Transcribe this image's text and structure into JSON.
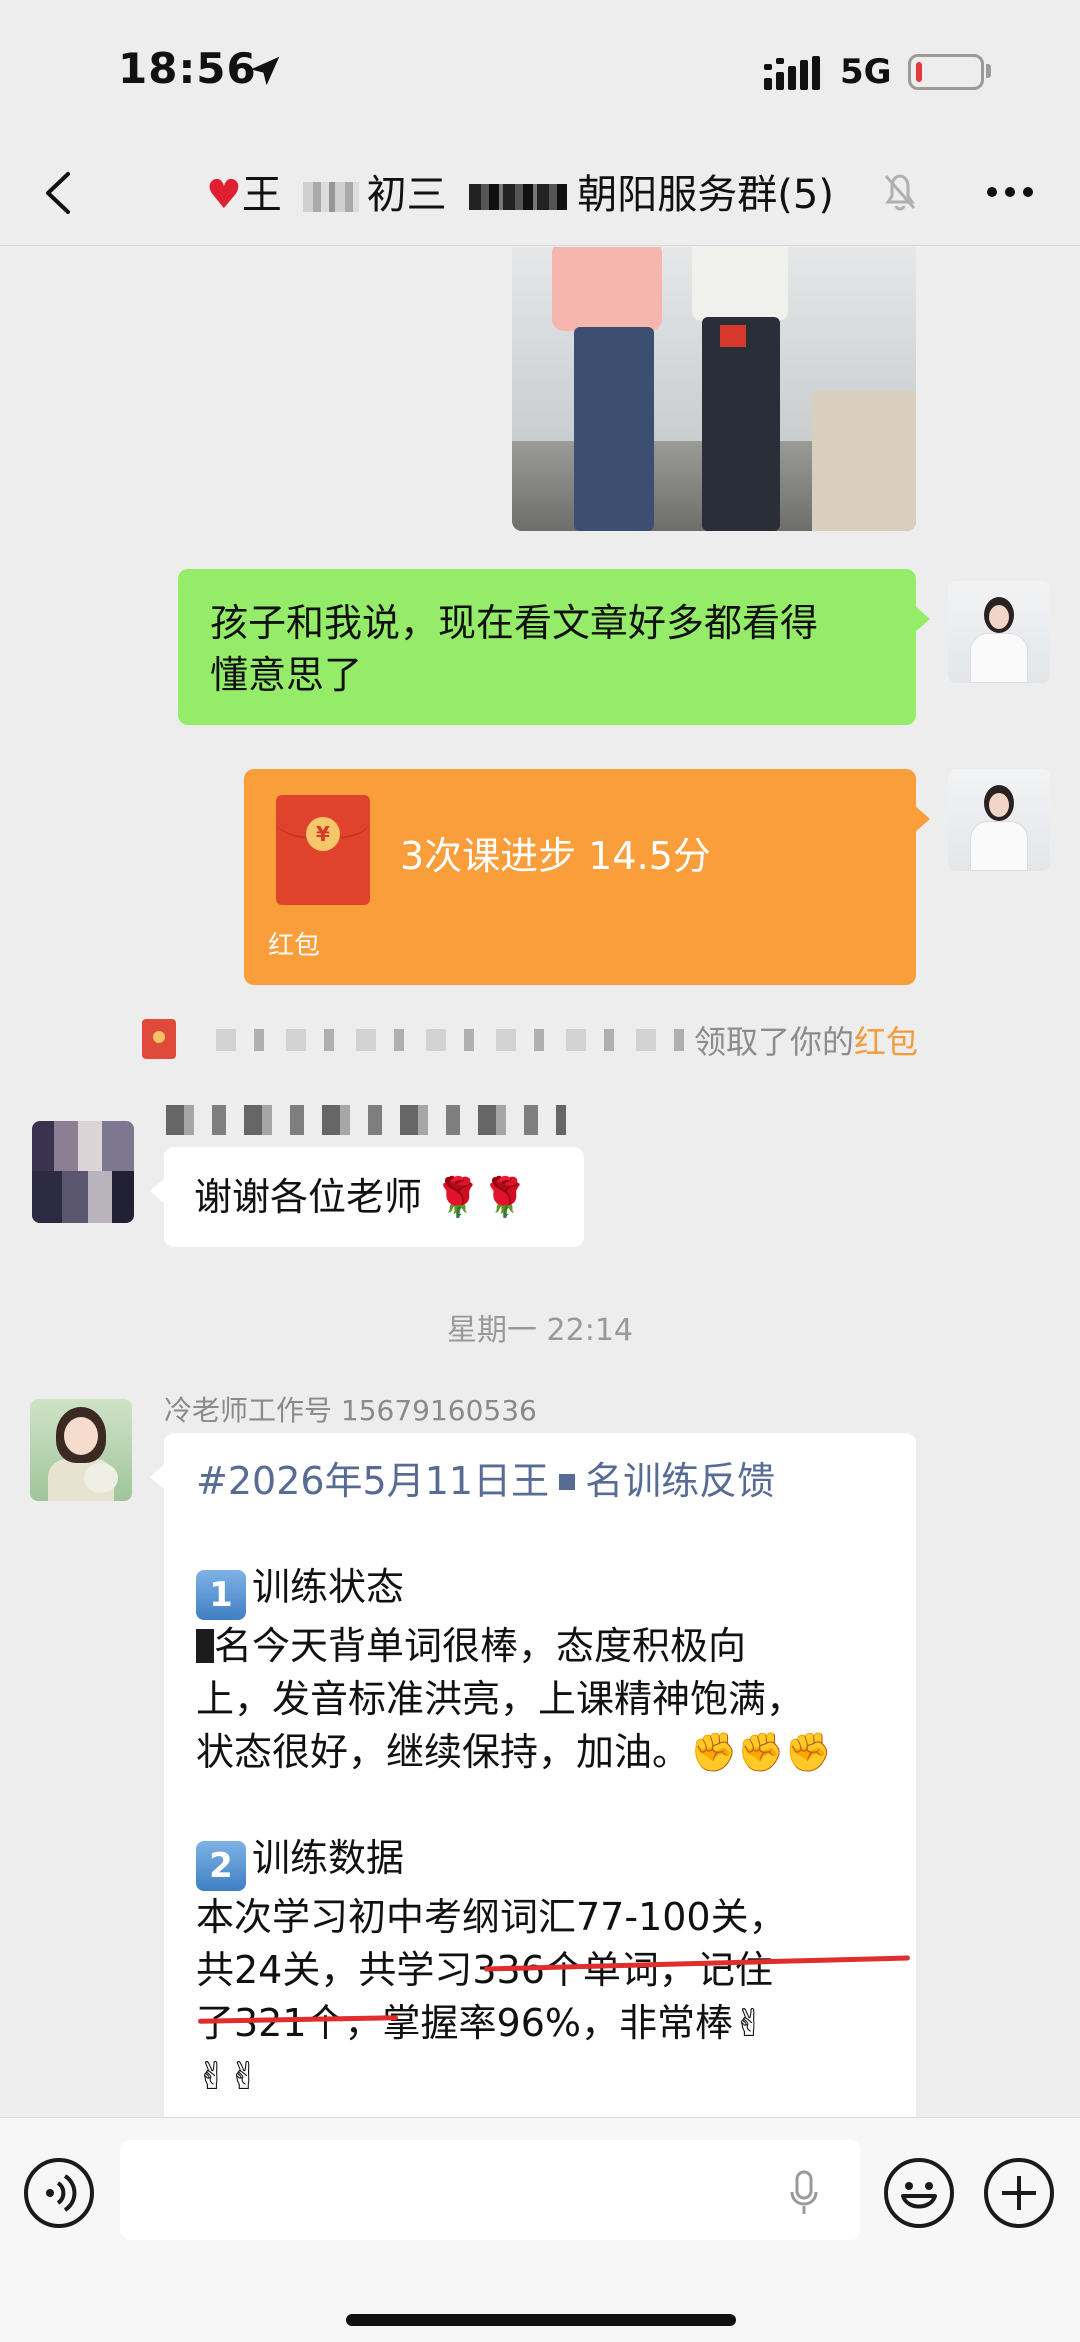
{
  "status_bar": {
    "time": "18:56",
    "network": "5G",
    "battery_level": 0.1,
    "battery_color": "#e4383a"
  },
  "nav": {
    "title_prefix": "王",
    "title_mid": "初三",
    "title_suffix": "朝阳服务群(5)",
    "icons": [
      "back-icon",
      "mute-bell-icon",
      "more-icon"
    ]
  },
  "messages": {
    "green_text": [
      "孩子和我说，现在看文章好多都看得",
      "懂意思了"
    ],
    "red_packet": {
      "title": "3次课进步 14.5分",
      "label": "红包",
      "coin": "¥"
    },
    "system": {
      "text": "领取了你的",
      "link": "红包"
    },
    "thanks": {
      "text": "谢谢各位老师",
      "emoji": "🌹🌹"
    },
    "timestamp": "星期一 22:14",
    "teacher_name": "冷老师工作号 15679160536",
    "report": {
      "title_a": "#2026年5月11日王",
      "title_b": "名训练反馈",
      "s1_num": "1",
      "s1_title": "训练状态",
      "s1_l1": "名今天背单词很棒，态度积极向",
      "s1_l2": "上，发音标准洪亮，上课精神饱满，",
      "s1_l3": "状态很好，继续保持，加油。✊✊✊",
      "s2_num": "2",
      "s2_title": "训练数据",
      "s2_l1": "本次学习初中考纲词汇77-100关，",
      "s2_l2": "共24关，共学习336个单词，记住",
      "s2_l3": "了321个，掌握率96%，非常棒✌",
      "s2_l4": "✌✌"
    }
  },
  "colors": {
    "self_bubble": "#95ec69",
    "red_packet": "#fa9d3b",
    "link": "#576b95",
    "underline": "#e02d2d"
  },
  "input_bar": {
    "icons": [
      "voice-icon",
      "microphone-icon",
      "emoji-icon",
      "plus-icon"
    ]
  }
}
